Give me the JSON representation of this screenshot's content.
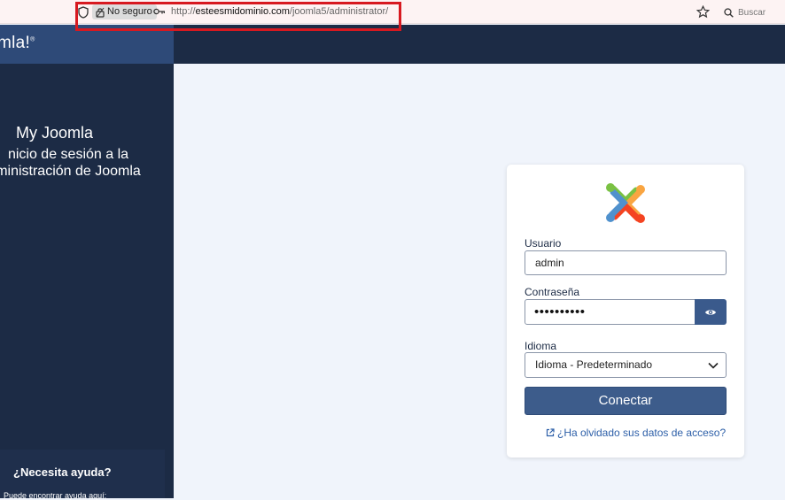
{
  "browser": {
    "security_label": "No seguro",
    "url_prefix": "http://",
    "url_host": "esteesmidominio.com",
    "url_path": "/joomla5/administrator/",
    "search_placeholder": "Buscar",
    "highlight_color": "#d71920"
  },
  "header": {
    "logo_text": "mla!",
    "logo_mark": "®"
  },
  "sidebar": {
    "site_name": "My Joomla",
    "login_description": "nicio de sesión a la ministración de Joomla",
    "help_title": "¿Necesita ayuda?",
    "help_text": "Puede encontrar ayuda aquí:"
  },
  "login": {
    "username_label": "Usuario",
    "username_value": "admin",
    "password_label": "Contraseña",
    "password_value": "••••••••••",
    "language_label": "Idioma",
    "language_value": "Idioma - Predeterminado",
    "submit_label": "Conectar",
    "forgot_link": "¿Ha olvidado sus datos de acceso?"
  },
  "colors": {
    "sidebar_bg": "#1c2b45",
    "accent": "#3d5c8b",
    "page_bg": "#f0f4fb"
  },
  "icons": [
    "shield-icon",
    "lock-icon",
    "key-icon",
    "star-icon",
    "search-icon",
    "joomla-logo-icon",
    "eye-icon",
    "chevron-down-icon",
    "external-link-icon"
  ]
}
